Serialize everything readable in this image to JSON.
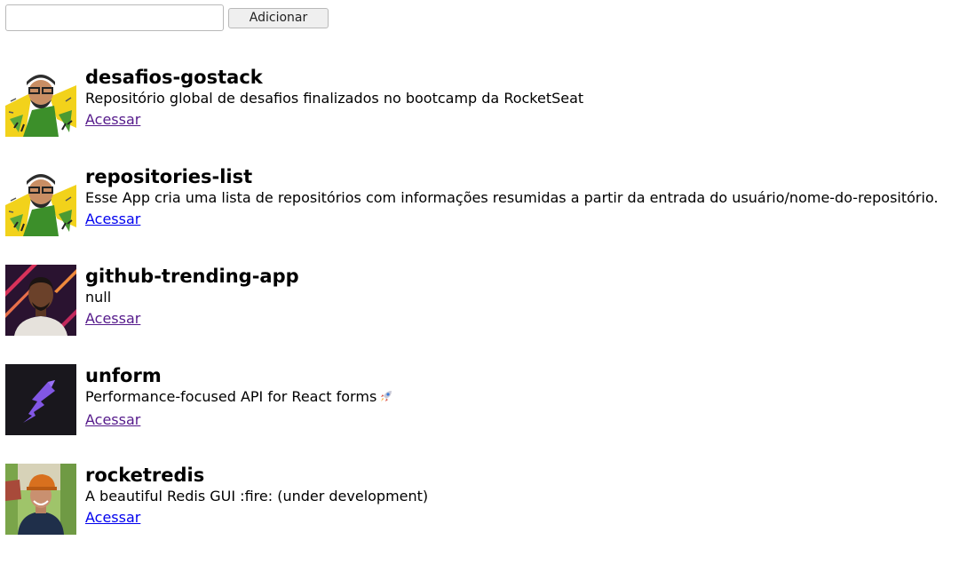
{
  "form": {
    "input_value": "",
    "input_placeholder": "",
    "add_button_label": "Adicionar"
  },
  "repositories": [
    {
      "name": "desafios-gostack",
      "description": "Repositório global de desafios finalizados no bootcamp da RocketSeat",
      "link_label": "Acessar",
      "link_state": "visited",
      "avatar": "avatar-sketch-portrait"
    },
    {
      "name": "repositories-list",
      "description": "Esse App cria uma lista de repositórios com informações resumidas a partir da entrada do usuário/nome-do-repositório.",
      "link_label": "Acessar",
      "link_state": "unvisited",
      "avatar": "avatar-sketch-portrait"
    },
    {
      "name": "github-trending-app",
      "description": "null",
      "link_label": "Acessar",
      "link_state": "visited",
      "avatar": "avatar-photo-portrait"
    },
    {
      "name": "unform",
      "description": "Performance-focused API for React forms",
      "description_emoji": "rocket-emoji",
      "link_label": "Acessar",
      "link_state": "visited",
      "avatar": "unform-logo"
    },
    {
      "name": "rocketredis",
      "description": "A beautiful Redis GUI :fire: (under development)",
      "link_label": "Acessar",
      "link_state": "unvisited",
      "avatar": "avatar-photo-outdoor"
    }
  ],
  "colors": {
    "link_visited": "#551a8b",
    "link_unvisited": "#0000ee",
    "button_bg": "#efefef",
    "border": "#b9b9b9"
  }
}
